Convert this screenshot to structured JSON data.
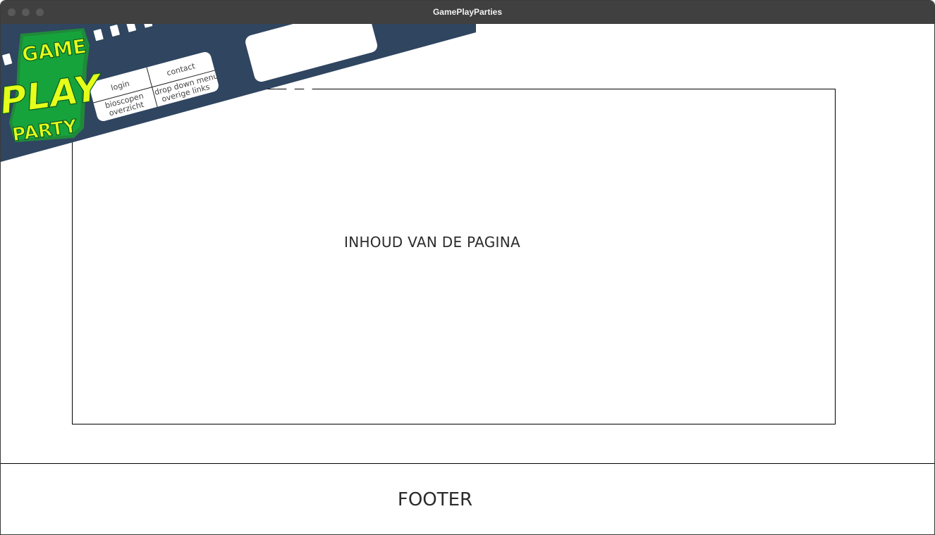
{
  "window": {
    "title": "GamePlayParties"
  },
  "logo": {
    "line1": "GAME",
    "line2": "PLAY",
    "line3": "PARTY"
  },
  "nav": {
    "login": "login",
    "contact": "contact",
    "bioscopen_line1": "bioscopen",
    "bioscopen_line2": "overzicht",
    "dropdown_line1": "drop down menu",
    "dropdown_line2": "overige links"
  },
  "main": {
    "text": "INHOUD VAN DE PAGINA"
  },
  "footer": {
    "text": "FOOTER"
  },
  "colors": {
    "film_strip": "#2f4560",
    "logo_green": "#1f8a3a",
    "logo_text": "#e6ff1a",
    "titlebar": "#404040"
  }
}
